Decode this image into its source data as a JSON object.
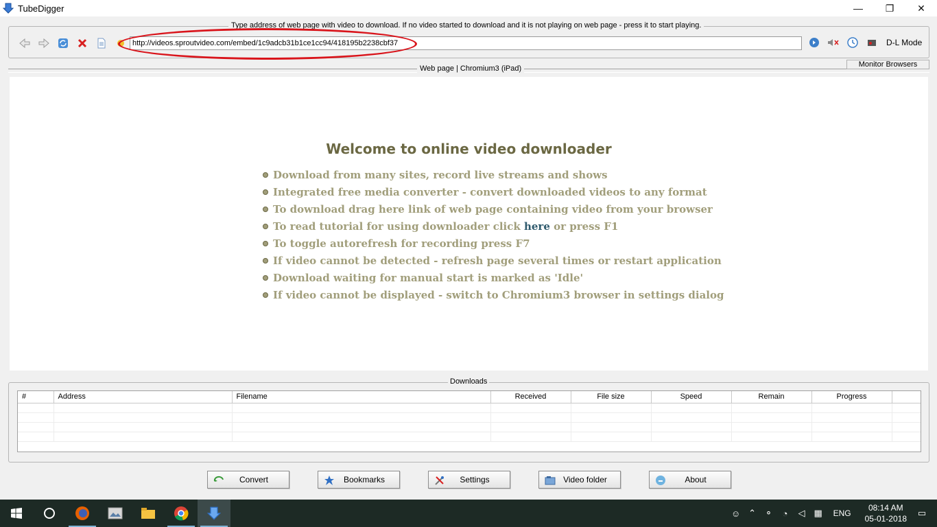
{
  "window": {
    "title": "TubeDigger",
    "minimize": "—",
    "maximize": "❐",
    "close": "✕"
  },
  "address_bar": {
    "legend": "Type address of web page with video to download. If no video started to download and it is not playing on web page - press it to start playing.",
    "url": "http://videos.sproutvideo.com/embed/1c9adcb31b1ce1cc94/418195b2238cbf37",
    "dl_mode_label": "D-L Mode",
    "nav_icons": [
      "back-icon",
      "forward-icon",
      "refresh-icon",
      "stop-icon",
      "page-icon",
      "favorite-icon"
    ],
    "right_icons": [
      "go-icon",
      "mute-icon",
      "timer-icon",
      "record-icon"
    ]
  },
  "tab": {
    "caption": "Web page | Chromium3 (iPad)",
    "monitor_button": "Monitor Browsers"
  },
  "web_page": {
    "heading": "Welcome to online video downloader",
    "bullets": [
      "Download from many sites, record live streams and shows",
      "Integrated free media converter - convert downloaded videos to any format",
      "To download drag here link of web page containing video from your browser",
      "To read tutorial for using downloader click",
      "To toggle autorefresh for recording press F7",
      "If video cannot be detected - refresh page several times or restart application",
      "Download waiting for manual start is marked as 'Idle'",
      "If video cannot be displayed - switch to Chromium3 browser in settings dialog"
    ],
    "tutorial_link": "here",
    "tutorial_suffix": " or press F1"
  },
  "downloads": {
    "legend": "Downloads",
    "columns": [
      "#",
      "Address",
      "Filename",
      "Received",
      "File size",
      "Speed",
      "Remain",
      "Progress"
    ],
    "rows": []
  },
  "buttons": {
    "convert": "Convert",
    "bookmarks": "Bookmarks",
    "settings": "Settings",
    "video_folder": "Video folder",
    "about": "About"
  },
  "taskbar": {
    "apps": [
      "windows-start-icon",
      "cortana-icon",
      "firefox-icon",
      "photos-icon",
      "file-explorer-icon",
      "chrome-icon",
      "tubedigger-icon"
    ],
    "language": "ENG",
    "time": "08:14 AM",
    "date": "05-01-2018"
  }
}
